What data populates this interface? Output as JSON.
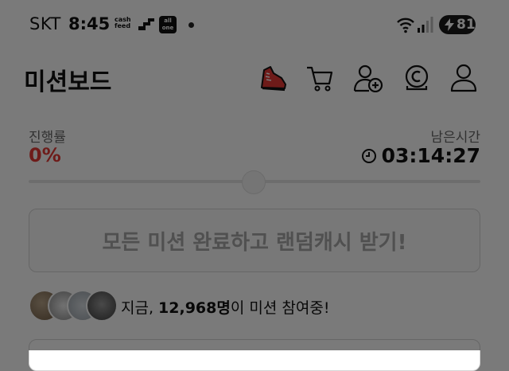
{
  "status_bar": {
    "carrier": "SKT",
    "time": "8:45",
    "cashfeed_label": "cash feed",
    "allone_label": "all one",
    "battery_level": "81"
  },
  "header": {
    "title": "미션보드",
    "icons": [
      "sneaker-icon",
      "cart-icon",
      "add-user-icon",
      "coin-icon",
      "profile-icon"
    ]
  },
  "progress": {
    "label": "진행률",
    "value": "0%",
    "fraction": 0,
    "remaining_label": "남은시간",
    "remaining_time": "03:14:27"
  },
  "reward_button": {
    "label": "모든 미션 완료하고 랜덤캐시 받기!"
  },
  "participants": {
    "prefix": "지금, ",
    "count": "12,968명",
    "suffix": "이 미션 참여중!"
  },
  "colors": {
    "accent": "#e53935",
    "text": "#111111",
    "muted": "#666666"
  }
}
